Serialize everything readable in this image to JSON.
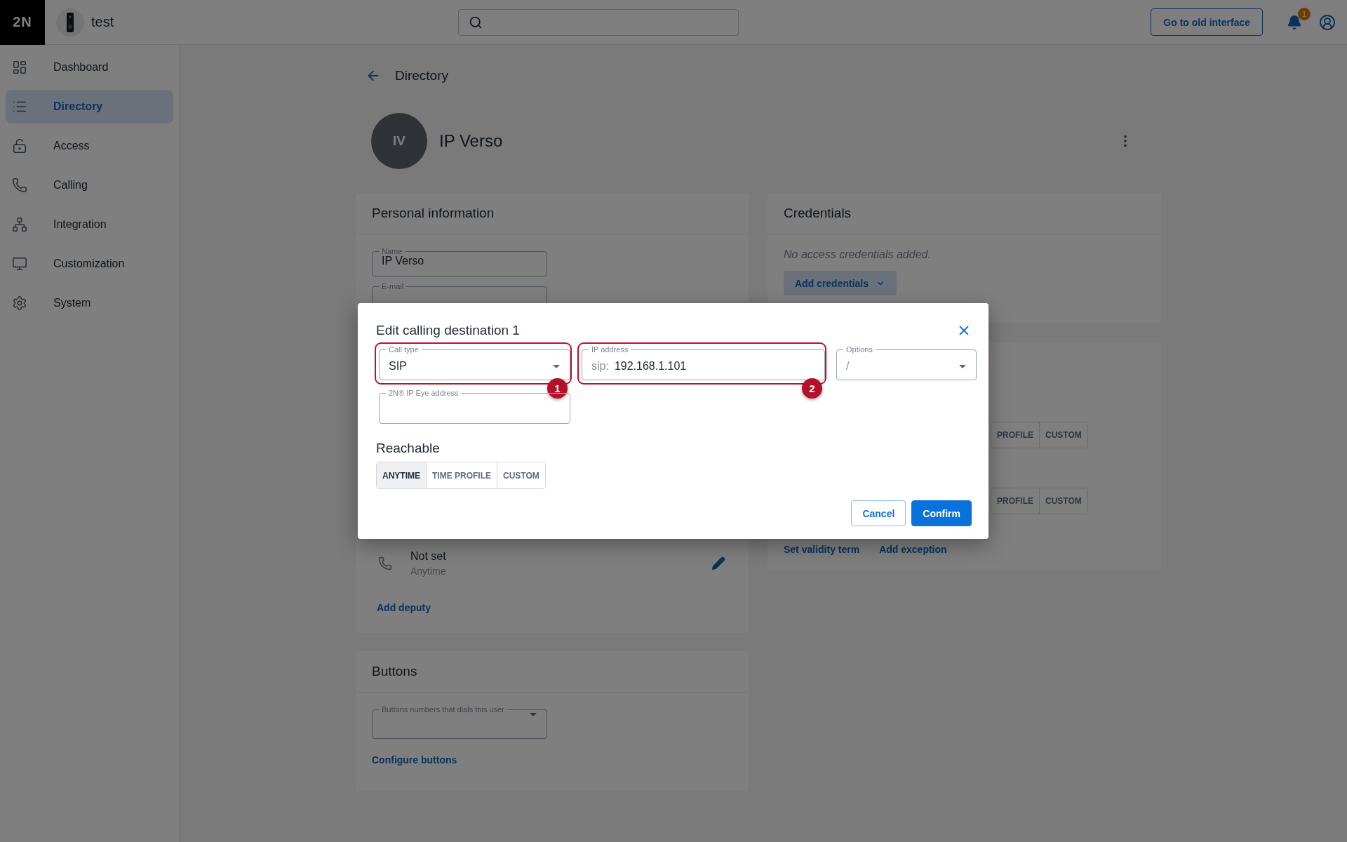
{
  "top_bar": {
    "brand": "2N",
    "device_name": "test",
    "old_interface_button": "Go to old interface",
    "notifications_badge": "1"
  },
  "sidebar": {
    "items": [
      {
        "label": "Dashboard",
        "selected": false
      },
      {
        "label": "Directory",
        "selected": true
      },
      {
        "label": "Access",
        "selected": false
      },
      {
        "label": "Calling",
        "selected": false
      },
      {
        "label": "Integration",
        "selected": false
      },
      {
        "label": "Customization",
        "selected": false
      },
      {
        "label": "System",
        "selected": false
      }
    ]
  },
  "page": {
    "title": "Directory",
    "user": {
      "initials": "IV",
      "name": "IP Verso"
    }
  },
  "personal_information": {
    "title": "Personal information",
    "fields": [
      {
        "label": "Name",
        "value": "IP Verso"
      },
      {
        "label": "E-mail"
      }
    ],
    "destination": {
      "primary": "Not set",
      "secondary": "Anytime"
    },
    "add_deputy": "Add deputy"
  },
  "buttons_card": {
    "title": "Buttons",
    "field": {
      "label": "Buttons numbers that dials this user"
    },
    "link": "Configure buttons"
  },
  "credentials": {
    "title": "Credentials",
    "empty_text": "No access credentials added.",
    "add_button": "Add credentials"
  },
  "access_card": {
    "segments": [
      [
        "PROFILE",
        "CUSTOM"
      ],
      [
        "PROFILE",
        "CUSTOM"
      ]
    ],
    "links": [
      "Set validity term",
      "Add exception"
    ]
  },
  "dialog": {
    "title": "Edit calling destination 1",
    "fields": [
      {
        "kind": "select",
        "label": "Call type",
        "value": "SIP",
        "callout": "1"
      },
      {
        "kind": "text",
        "label": "IP address",
        "prefix": "sip:",
        "value": "192.168.1.101",
        "callout": "2"
      },
      {
        "kind": "select",
        "label": "Options",
        "placeholder": "/"
      },
      {
        "kind": "text",
        "label": "2N® IP Eye address"
      }
    ],
    "reachable": {
      "title": "Reachable",
      "options": [
        {
          "label": "ANYTIME",
          "selected": true
        },
        {
          "label": "TIME PROFILE",
          "selected": false
        },
        {
          "label": "CUSTOM",
          "selected": false
        }
      ]
    },
    "cancel": "Cancel",
    "confirm": "Confirm"
  }
}
